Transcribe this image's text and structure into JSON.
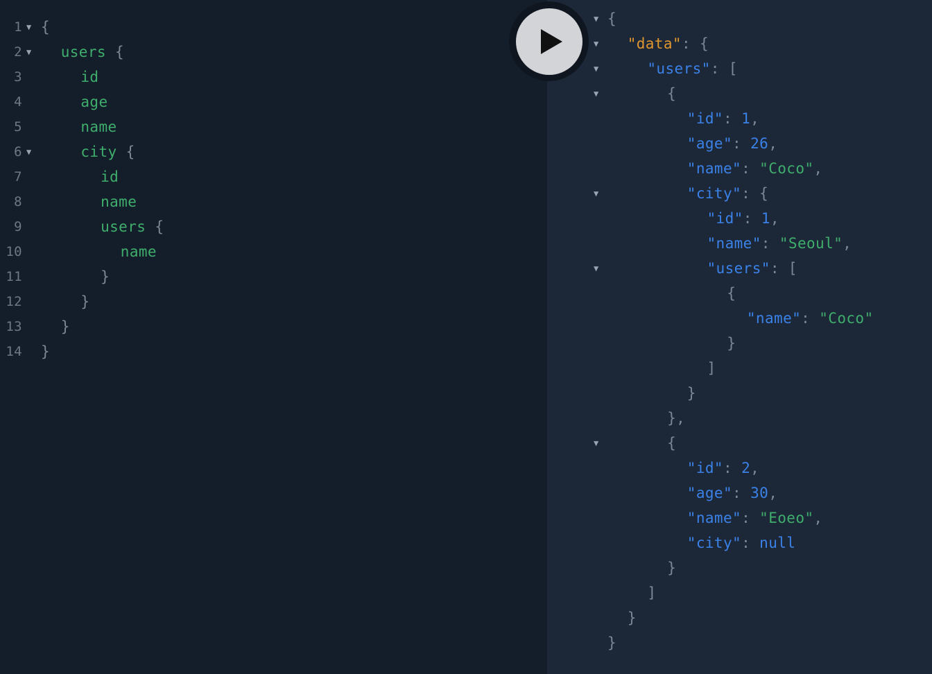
{
  "query_editor": {
    "lines": [
      {
        "n": "1",
        "fold": true,
        "t": [
          [
            "p",
            "{"
          ]
        ]
      },
      {
        "n": "2",
        "fold": true,
        "t": [
          [
            "f",
            "users"
          ],
          [
            "p",
            " {"
          ]
        ]
      },
      {
        "n": "3",
        "fold": false,
        "t": [
          [
            "f",
            "id"
          ]
        ]
      },
      {
        "n": "4",
        "fold": false,
        "t": [
          [
            "f",
            "age"
          ]
        ]
      },
      {
        "n": "5",
        "fold": false,
        "t": [
          [
            "f",
            "name"
          ]
        ]
      },
      {
        "n": "6",
        "fold": true,
        "t": [
          [
            "f",
            "city"
          ],
          [
            "p",
            " {"
          ]
        ]
      },
      {
        "n": "7",
        "fold": false,
        "t": [
          [
            "f",
            "id"
          ]
        ]
      },
      {
        "n": "8",
        "fold": false,
        "t": [
          [
            "f",
            "name"
          ]
        ]
      },
      {
        "n": "9",
        "fold": false,
        "t": [
          [
            "f",
            "users"
          ],
          [
            "p",
            " {"
          ]
        ]
      },
      {
        "n": "10",
        "fold": false,
        "t": [
          [
            "f",
            "name"
          ]
        ]
      },
      {
        "n": "11",
        "fold": false,
        "t": [
          [
            "p",
            "}"
          ]
        ]
      },
      {
        "n": "12",
        "fold": false,
        "t": [
          [
            "p",
            "}"
          ]
        ]
      },
      {
        "n": "13",
        "fold": false,
        "t": [
          [
            "p",
            "}"
          ]
        ]
      },
      {
        "n": "14",
        "fold": false,
        "t": [
          [
            "p",
            "}"
          ]
        ]
      }
    ]
  },
  "run_button": {
    "icon": "play-icon"
  },
  "result_viewer": {
    "lines": [
      {
        "fold": true,
        "t": [
          [
            "p",
            "{"
          ]
        ]
      },
      {
        "fold": true,
        "t": [
          [
            "kd",
            "\"data\""
          ],
          [
            "p",
            ": {"
          ]
        ]
      },
      {
        "fold": true,
        "t": [
          [
            "k",
            "\"users\""
          ],
          [
            "p",
            ": ["
          ]
        ]
      },
      {
        "fold": true,
        "t": [
          [
            "p",
            "{"
          ]
        ]
      },
      {
        "fold": false,
        "t": [
          [
            "k",
            "\"id\""
          ],
          [
            "p",
            ": "
          ],
          [
            "n",
            "1"
          ],
          [
            "p",
            ","
          ]
        ]
      },
      {
        "fold": false,
        "t": [
          [
            "k",
            "\"age\""
          ],
          [
            "p",
            ": "
          ],
          [
            "n",
            "26"
          ],
          [
            "p",
            ","
          ]
        ]
      },
      {
        "fold": false,
        "t": [
          [
            "k",
            "\"name\""
          ],
          [
            "p",
            ": "
          ],
          [
            "s",
            "\"Coco\""
          ],
          [
            "p",
            ","
          ]
        ]
      },
      {
        "fold": true,
        "t": [
          [
            "k",
            "\"city\""
          ],
          [
            "p",
            ": {"
          ]
        ]
      },
      {
        "fold": false,
        "t": [
          [
            "k",
            "\"id\""
          ],
          [
            "p",
            ": "
          ],
          [
            "n",
            "1"
          ],
          [
            "p",
            ","
          ]
        ]
      },
      {
        "fold": false,
        "t": [
          [
            "k",
            "\"name\""
          ],
          [
            "p",
            ": "
          ],
          [
            "s",
            "\"Seoul\""
          ],
          [
            "p",
            ","
          ]
        ]
      },
      {
        "fold": true,
        "t": [
          [
            "k",
            "\"users\""
          ],
          [
            "p",
            ": ["
          ]
        ]
      },
      {
        "fold": false,
        "t": [
          [
            "p",
            "{"
          ]
        ]
      },
      {
        "fold": false,
        "t": [
          [
            "k",
            "\"name\""
          ],
          [
            "p",
            ": "
          ],
          [
            "s",
            "\"Coco\""
          ]
        ]
      },
      {
        "fold": false,
        "t": [
          [
            "p",
            "}"
          ]
        ]
      },
      {
        "fold": false,
        "t": [
          [
            "p",
            "]"
          ]
        ]
      },
      {
        "fold": false,
        "t": [
          [
            "p",
            "}"
          ]
        ]
      },
      {
        "fold": false,
        "t": [
          [
            "p",
            "},"
          ]
        ]
      },
      {
        "fold": true,
        "t": [
          [
            "p",
            "{"
          ]
        ]
      },
      {
        "fold": false,
        "t": [
          [
            "k",
            "\"id\""
          ],
          [
            "p",
            ": "
          ],
          [
            "n",
            "2"
          ],
          [
            "p",
            ","
          ]
        ]
      },
      {
        "fold": false,
        "t": [
          [
            "k",
            "\"age\""
          ],
          [
            "p",
            ": "
          ],
          [
            "n",
            "30"
          ],
          [
            "p",
            ","
          ]
        ]
      },
      {
        "fold": false,
        "t": [
          [
            "k",
            "\"name\""
          ],
          [
            "p",
            ": "
          ],
          [
            "s",
            "\"Eoeo\""
          ],
          [
            "p",
            ","
          ]
        ]
      },
      {
        "fold": false,
        "t": [
          [
            "k",
            "\"city\""
          ],
          [
            "p",
            ": "
          ],
          [
            "u",
            "null"
          ]
        ]
      },
      {
        "fold": false,
        "t": [
          [
            "p",
            "}"
          ]
        ]
      },
      {
        "fold": false,
        "t": [
          [
            "p",
            "]"
          ]
        ]
      },
      {
        "fold": false,
        "t": [
          [
            "p",
            "}"
          ]
        ]
      },
      {
        "fold": false,
        "t": [
          [
            "p",
            "}"
          ]
        ]
      }
    ]
  },
  "colors": {
    "editor_bg": "#141e2a",
    "result_bg": "#1c2838",
    "field": "#3fae6c",
    "key": "#3b82e8",
    "data_key": "#e0962e",
    "punctuation": "#7d8897"
  }
}
